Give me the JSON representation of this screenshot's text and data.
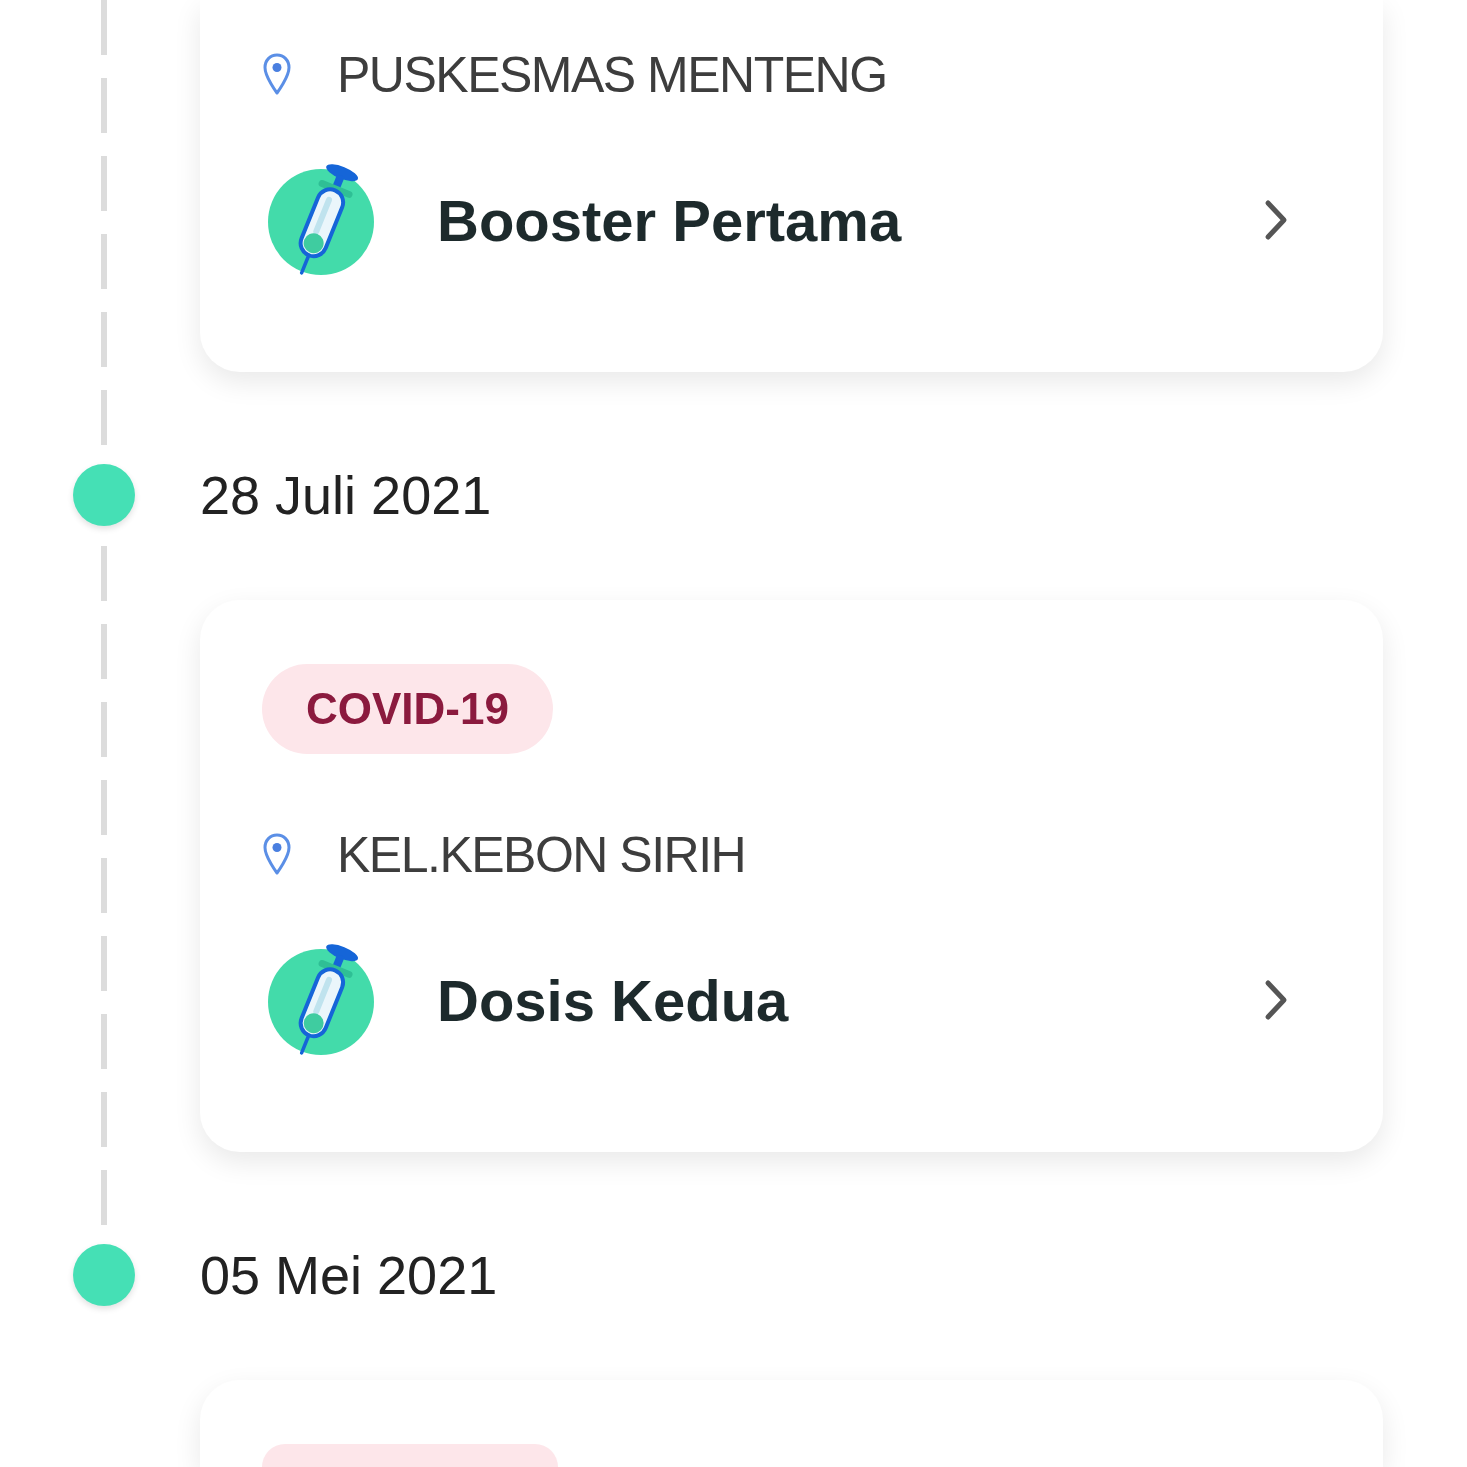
{
  "timeline": [
    {
      "card": {
        "kind": "clipped_top",
        "location": "PUSKESMAS MENTENG",
        "title": "Booster Pertama"
      }
    },
    {
      "date": "28 Juli 2021",
      "card": {
        "kind": "full",
        "tag": "COVID-19",
        "location": "KEL.KEBON SIRIH",
        "title": "Dosis Kedua"
      }
    },
    {
      "date": "05 Mei 2021",
      "card": {
        "kind": "clipped_bottom"
      }
    }
  ]
}
